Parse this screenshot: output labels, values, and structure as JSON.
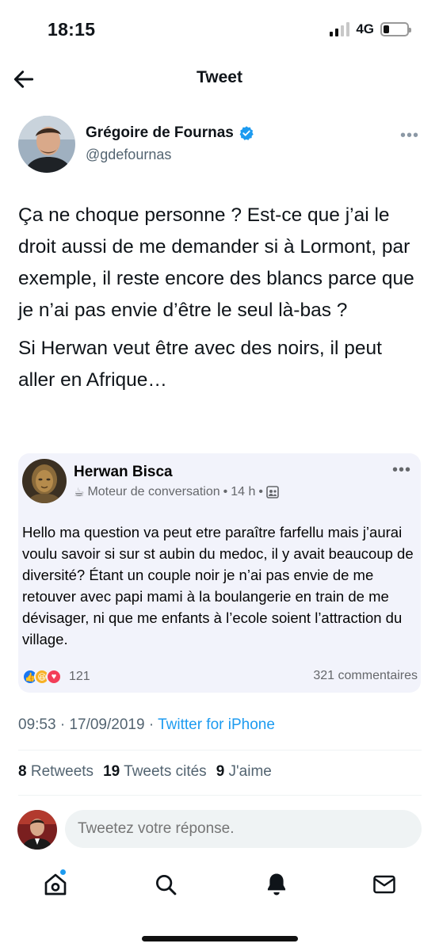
{
  "status_bar": {
    "time": "18:15",
    "network": "4G",
    "battery_level": 0.25
  },
  "header": {
    "title": "Tweet",
    "back_icon": "arrow-left-icon"
  },
  "author": {
    "name": "Grégoire de Fournas",
    "handle": "@gdefournas",
    "verified": true,
    "more_icon": "more-dots-icon"
  },
  "tweet": {
    "paragraphs": [
      "Ça ne choque personne ? Est-ce que j’ai le droit aussi de me demander si à Lormont, par exemple, il reste encore des blancs parce que je n’ai pas envie d’être le seul là-bas ?",
      "Si Herwan veut être avec des noirs, il peut aller en Afrique…"
    ]
  },
  "quote": {
    "name": "Herwan Bisca",
    "group": "Moteur de conversation",
    "time": "14 h",
    "separator": "•",
    "body": "Hello ma question va peut etre paraître farfellu mais j’aurai voulu savoir si sur st aubin du medoc, il y avait beaucoup de diversité? Étant un couple noir je n’ai pas envie de me retouver avec papi mami à la boulangerie en train de me dévisager, ni que me enfants à l’ecole soient l’attraction du village.",
    "reactions_count": "121",
    "comments": "321 commentaires"
  },
  "meta": {
    "time": "09:53",
    "date": "17/09/2019",
    "separator": "·",
    "source": "Twitter for iPhone"
  },
  "stats": {
    "retweets_count": "8",
    "retweets_label": "Retweets",
    "quotes_count": "19",
    "quotes_label": "Tweets cités",
    "likes_count": "9",
    "likes_label": "J'aime"
  },
  "reply": {
    "placeholder": "Tweetez votre réponse."
  },
  "tabs": [
    {
      "icon": "home-icon"
    },
    {
      "icon": "search-icon"
    },
    {
      "icon": "bell-icon"
    },
    {
      "icon": "mail-icon"
    }
  ],
  "colors": {
    "accent": "#1d9bf0",
    "text": "#0f1419",
    "secondary": "#536471",
    "quote_bg": "#f2f3fb"
  }
}
